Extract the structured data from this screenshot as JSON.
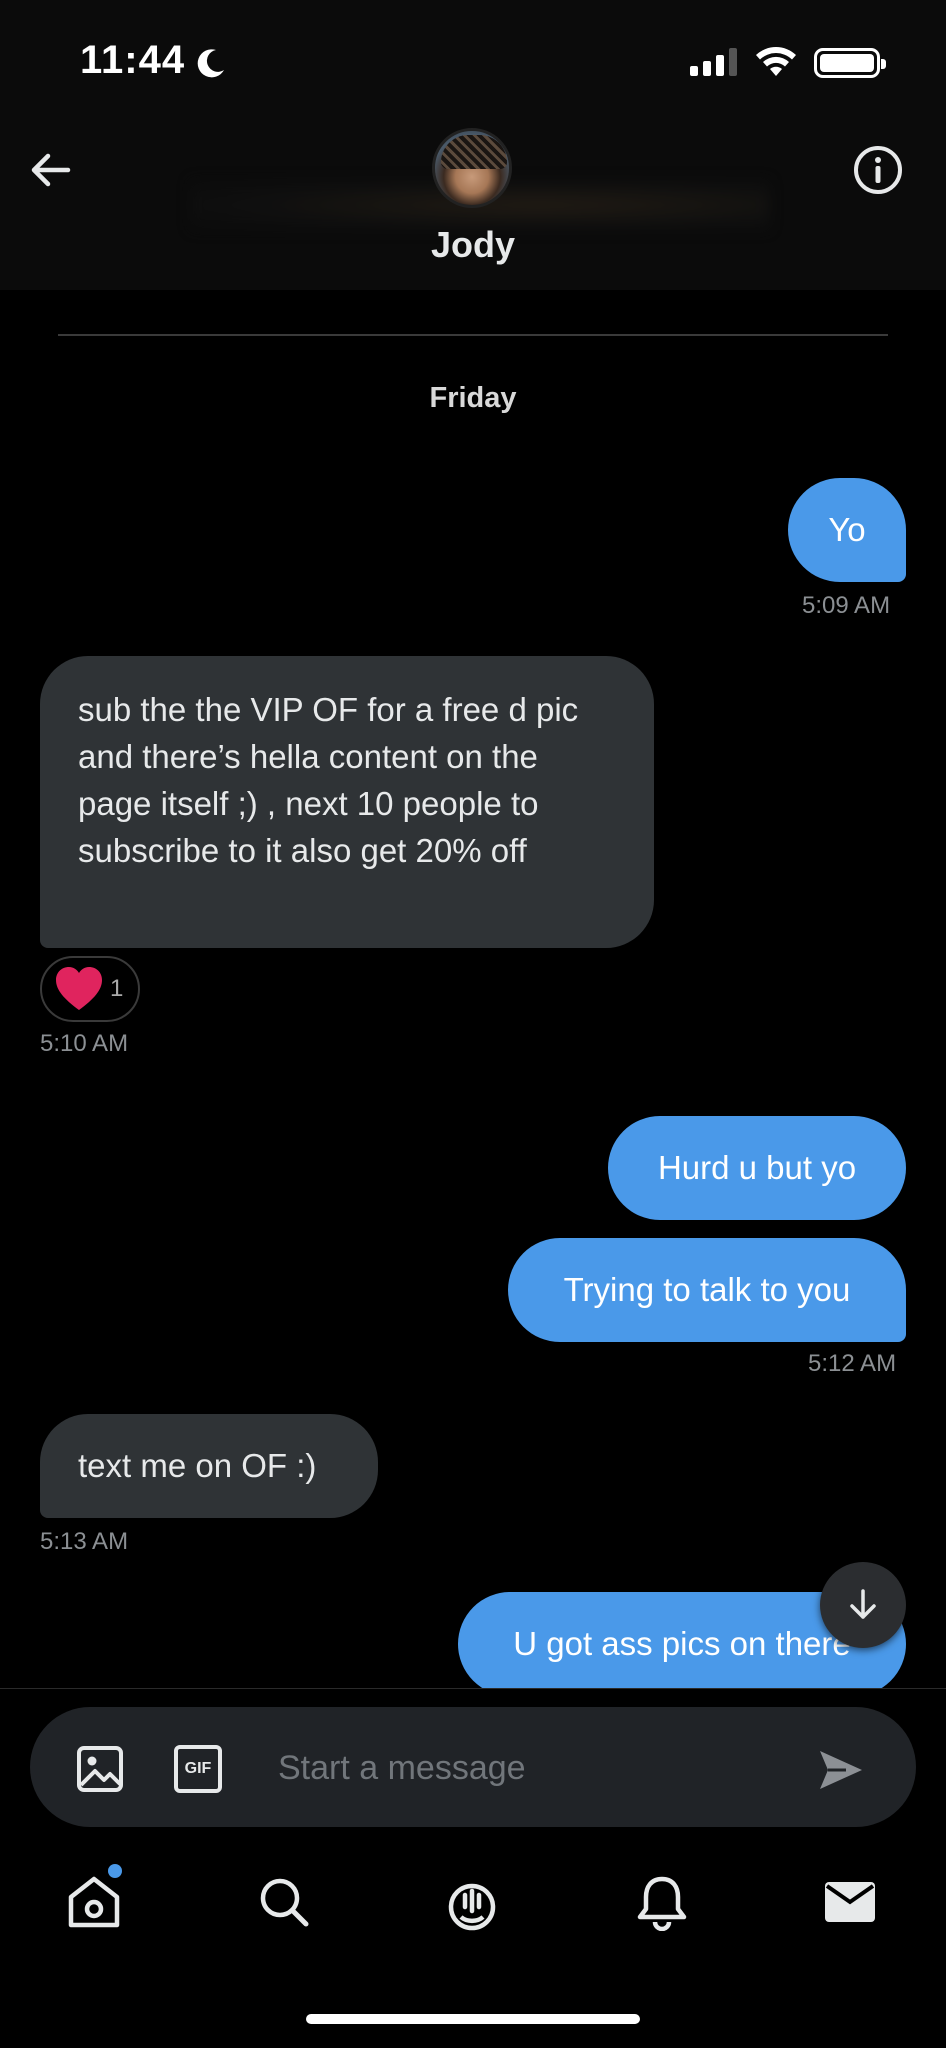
{
  "status_bar": {
    "time": "11:44"
  },
  "header": {
    "contact_name": "Jody",
    "back_icon": "arrow-left-icon",
    "info_icon": "info-circle-icon"
  },
  "conversation": {
    "day_label": "Friday",
    "messages": [
      {
        "direction": "out",
        "text": "Yo",
        "time": "5:09 AM"
      },
      {
        "direction": "in",
        "text": "sub the the VIP OF for a free d pic and there’s hella content on the page itself ;) , next 10 people to subscribe to it also get 20% off",
        "time": "5:10 AM",
        "reaction": {
          "icon": "heart-icon",
          "count": "1"
        }
      },
      {
        "direction": "out",
        "text": "Hurd u but yo"
      },
      {
        "direction": "out",
        "text": "Trying to talk to you",
        "time": "5:12 AM"
      },
      {
        "direction": "in",
        "text": "text me on OF :)",
        "time": "5:13 AM"
      },
      {
        "direction": "out",
        "text": "U got ass pics on there"
      }
    ]
  },
  "composer": {
    "placeholder": "Start a message",
    "gif_label": "GIF"
  },
  "tab_bar": {
    "items": [
      "home-icon",
      "search-icon",
      "spaces-icon",
      "notifications-icon",
      "messages-icon"
    ],
    "home_has_badge": true
  },
  "colors": {
    "outgoing_bubble": "#4a99e9",
    "incoming_bubble": "#2f3336",
    "background": "#000000",
    "heart": "#e0245e"
  }
}
